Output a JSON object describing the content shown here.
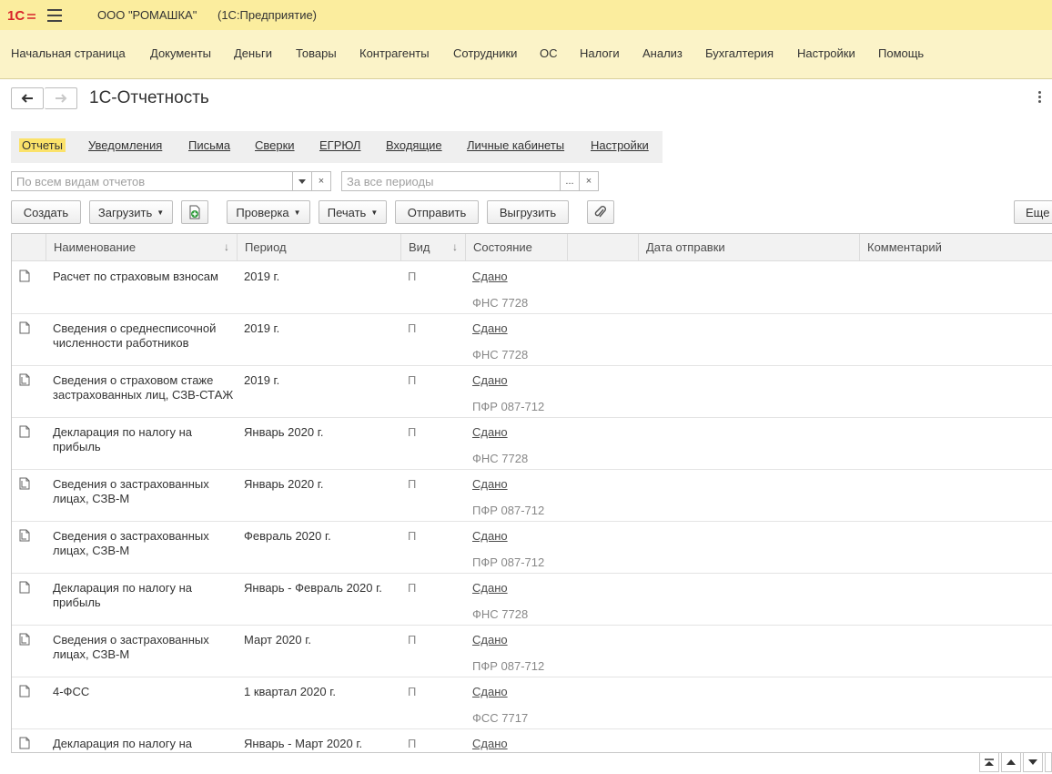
{
  "titlebar": {
    "org": "ООО \"РОМАШКА\"",
    "app": "(1С:Предприятие)"
  },
  "sections": [
    "Начальная страница",
    "Документы",
    "Деньги",
    "Товары",
    "Контрагенты",
    "Сотрудники",
    "ОС",
    "Налоги",
    "Анализ",
    "Бухгалтерия",
    "Настройки",
    "Помощь"
  ],
  "page": {
    "title": "1С-Отчетность"
  },
  "tabs": [
    "Отчеты",
    "Уведомления",
    "Письма",
    "Сверки",
    "ЕГРЮЛ",
    "Входящие",
    "Личные кабинеты",
    "Настройки"
  ],
  "filters": {
    "kind_placeholder": "По всем видам отчетов",
    "period_placeholder": "За все периоды",
    "dots": "...",
    "clear": "×"
  },
  "toolbar": {
    "create": "Создать",
    "load": "Загрузить",
    "check": "Проверка",
    "print": "Печать",
    "send": "Отправить",
    "export": "Выгрузить",
    "more": "Еще"
  },
  "columns": {
    "name": "Наименование",
    "period": "Период",
    "kind": "Вид",
    "state": "Состояние",
    "sent": "Дата отправки",
    "comment": "Комментарий"
  },
  "rows": [
    {
      "icon": "document-icon",
      "name": "Расчет по страховым взносам",
      "period": "2019 г.",
      "kind": "П",
      "status": "Сдано",
      "recipient": "ФНС 7728"
    },
    {
      "icon": "document-icon",
      "name": "Сведения о среднесписочной численности работников",
      "period": "2019 г.",
      "kind": "П",
      "status": "Сдано",
      "recipient": "ФНС 7728"
    },
    {
      "icon": "document-stack-icon",
      "name": "Сведения о страховом стаже застрахованных лиц, СЗВ-СТАЖ",
      "period": "2019 г.",
      "kind": "П",
      "status": "Сдано",
      "recipient": "ПФР 087-712"
    },
    {
      "icon": "document-icon",
      "name": "Декларация по налогу на прибыль",
      "period": "Январь 2020 г.",
      "kind": "П",
      "status": "Сдано",
      "recipient": "ФНС 7728"
    },
    {
      "icon": "document-stack-icon",
      "name": "Сведения о застрахованных лицах, СЗВ-М",
      "period": "Январь 2020 г.",
      "kind": "П",
      "status": "Сдано",
      "recipient": "ПФР 087-712"
    },
    {
      "icon": "document-stack-icon",
      "name": "Сведения о застрахованных лицах, СЗВ-М",
      "period": "Февраль 2020 г.",
      "kind": "П",
      "status": "Сдано",
      "recipient": "ПФР 087-712"
    },
    {
      "icon": "document-icon",
      "name": "Декларация по налогу на прибыль",
      "period": "Январь - Февраль 2020 г.",
      "kind": "П",
      "status": "Сдано",
      "recipient": "ФНС 7728"
    },
    {
      "icon": "document-stack-icon",
      "name": "Сведения о застрахованных лицах, СЗВ-М",
      "period": "Март 2020 г.",
      "kind": "П",
      "status": "Сдано",
      "recipient": "ПФР 087-712"
    },
    {
      "icon": "document-icon",
      "name": "4-ФСС",
      "period": "1 квартал 2020 г.",
      "kind": "П",
      "status": "Сдано",
      "recipient": "ФСС 7717"
    },
    {
      "icon": "document-icon",
      "name": "Декларация по налогу на прибыль",
      "period": "Январь - Март 2020 г.",
      "kind": "П",
      "status": "Сдано",
      "recipient": ""
    }
  ],
  "colors": {
    "titlebar": "#fbed9e",
    "sections": "#fbf3c8",
    "active_tab": "#fbe26a",
    "logo_red": "#d8232a"
  }
}
